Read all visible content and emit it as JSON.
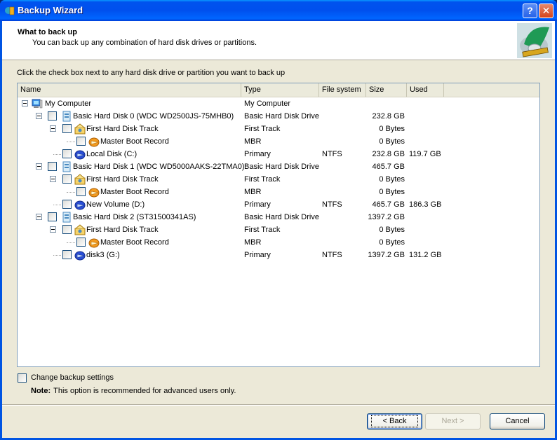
{
  "window": {
    "title": "Backup Wizard",
    "help_label": "?",
    "close_label": "✕"
  },
  "header": {
    "title": "What to back up",
    "subtitle": "You can back up any combination of hard disk drives or partitions."
  },
  "instruction": "Click the check box next to any hard disk drive or partition you want to back up",
  "table": {
    "columns": [
      "Name",
      "Type",
      "File system",
      "Size",
      "Used"
    ],
    "rows": [
      {
        "name": "My Computer",
        "type": "My Computer",
        "fs": "",
        "size": "",
        "used": "",
        "icon": "computer-icon",
        "level": 0
      },
      {
        "name": "Basic Hard Disk 0 (WDC WD2500JS-75MHB0)",
        "type": "Basic Hard Disk Drive",
        "fs": "",
        "size": "232.8 GB",
        "used": "",
        "icon": "hard-disk-icon",
        "level": 1
      },
      {
        "name": "First Hard Disk Track",
        "type": "First Track",
        "fs": "",
        "size": "0 Bytes",
        "used": "",
        "icon": "track-icon",
        "level": 2
      },
      {
        "name": "Master Boot Record",
        "type": "MBR",
        "fs": "",
        "size": "0 Bytes",
        "used": "",
        "icon": "mbr-icon",
        "level": 3
      },
      {
        "name": "Local Disk (C:)",
        "type": "Primary",
        "fs": "NTFS",
        "size": "232.8 GB",
        "used": "119.7 GB",
        "icon": "partition-icon",
        "level": 2
      },
      {
        "name": "Basic Hard Disk 1 (WDC WD5000AAKS-22TMA0)",
        "type": "Basic Hard Disk Drive",
        "fs": "",
        "size": "465.7 GB",
        "used": "",
        "icon": "hard-disk-icon",
        "level": 1
      },
      {
        "name": "First Hard Disk Track",
        "type": "First Track",
        "fs": "",
        "size": "0 Bytes",
        "used": "",
        "icon": "track-icon",
        "level": 2
      },
      {
        "name": "Master Boot Record",
        "type": "MBR",
        "fs": "",
        "size": "0 Bytes",
        "used": "",
        "icon": "mbr-icon",
        "level": 3
      },
      {
        "name": "New Volume (D:)",
        "type": "Primary",
        "fs": "NTFS",
        "size": "465.7 GB",
        "used": "186.3 GB",
        "icon": "partition-icon",
        "level": 2
      },
      {
        "name": "Basic Hard Disk 2 (ST31500341AS)",
        "type": "Basic Hard Disk Drive",
        "fs": "",
        "size": "1397.2 GB",
        "used": "",
        "icon": "hard-disk-icon",
        "level": 1
      },
      {
        "name": "First Hard Disk Track",
        "type": "First Track",
        "fs": "",
        "size": "0 Bytes",
        "used": "",
        "icon": "track-icon",
        "level": 2
      },
      {
        "name": "Master Boot Record",
        "type": "MBR",
        "fs": "",
        "size": "0 Bytes",
        "used": "",
        "icon": "mbr-icon",
        "level": 3
      },
      {
        "name": "disk3 (G:)",
        "type": "Primary",
        "fs": "NTFS",
        "size": "1397.2 GB",
        "used": "131.2 GB",
        "icon": "partition-icon",
        "level": 2
      }
    ]
  },
  "options": {
    "change_settings_label": "Change backup settings",
    "change_settings_checked": false,
    "note_label": "Note:",
    "note_text": "This option is recommended for advanced users only."
  },
  "buttons": {
    "back": "< Back",
    "next": "Next >",
    "cancel": "Cancel"
  }
}
